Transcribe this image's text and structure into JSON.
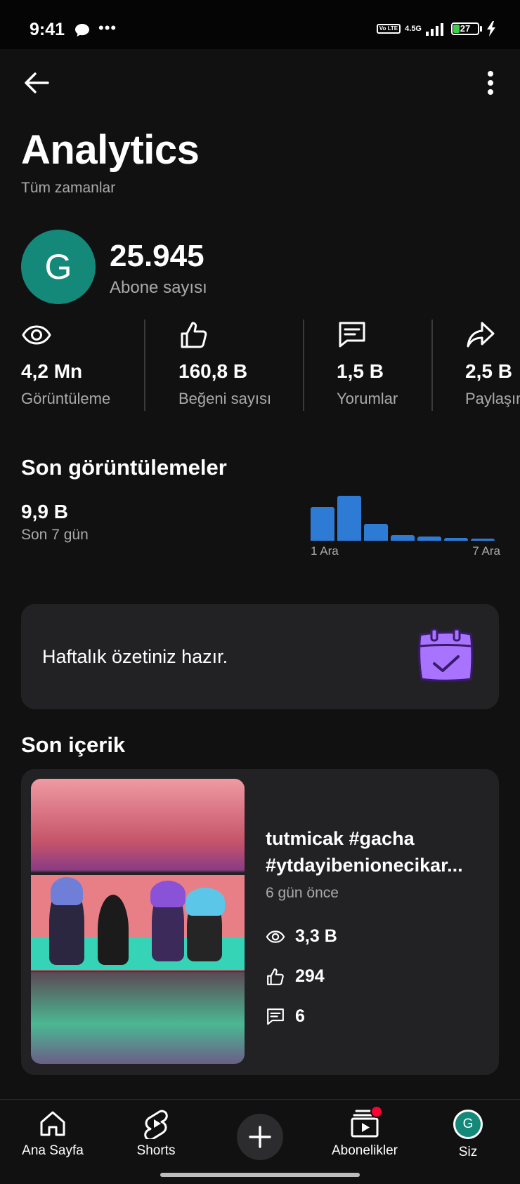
{
  "status_bar": {
    "time": "9:41",
    "network": "4.5G",
    "volte": "Vo LTE",
    "battery": "27",
    "battery_level": 0.27
  },
  "header": {
    "title": "Analytics",
    "subtitle": "Tüm zamanlar"
  },
  "channel": {
    "avatar_letter": "G",
    "avatar_color": "#14897a",
    "subscriber_count": "25.945",
    "subscriber_label": "Abone sayısı"
  },
  "stats": [
    {
      "icon": "eye-icon",
      "value": "4,2 Mn",
      "label": "Görüntüleme"
    },
    {
      "icon": "thumbs-up-icon",
      "value": "160,8 B",
      "label": "Beğeni sayısı"
    },
    {
      "icon": "comment-icon",
      "value": "1,5 B",
      "label": "Yorumlar"
    },
    {
      "icon": "share-icon",
      "value": "2,5 B",
      "label": "Paylaşım"
    }
  ],
  "recent_views": {
    "title": "Son görüntülemeler",
    "value": "9,9 B",
    "period": "Son 7 gün",
    "start_label": "1 Ara",
    "end_label": "7 Ara",
    "bar_color": "#2e7bd6",
    "relative_values": [
      0.75,
      1.0,
      0.38,
      0.13,
      0.1,
      0.06,
      0.05
    ]
  },
  "weekly_summary": {
    "text": "Haftalık özetiniz hazır.",
    "icon": "calendar-check-icon"
  },
  "recent_content": {
    "title": "Son içerik",
    "video": {
      "title_line1": "tutmicak #gacha",
      "title_line2": "#ytdayibenionecikar...",
      "date": "6 gün önce",
      "views": "3,3 B",
      "likes": "294",
      "comments": "6"
    }
  },
  "bottom_nav": {
    "home": "Ana Sayfa",
    "shorts": "Shorts",
    "create": "create-icon",
    "subscriptions": "Abonelikler",
    "you": "Siz",
    "you_avatar_letter": "G",
    "notification_color": "#ff0033"
  }
}
